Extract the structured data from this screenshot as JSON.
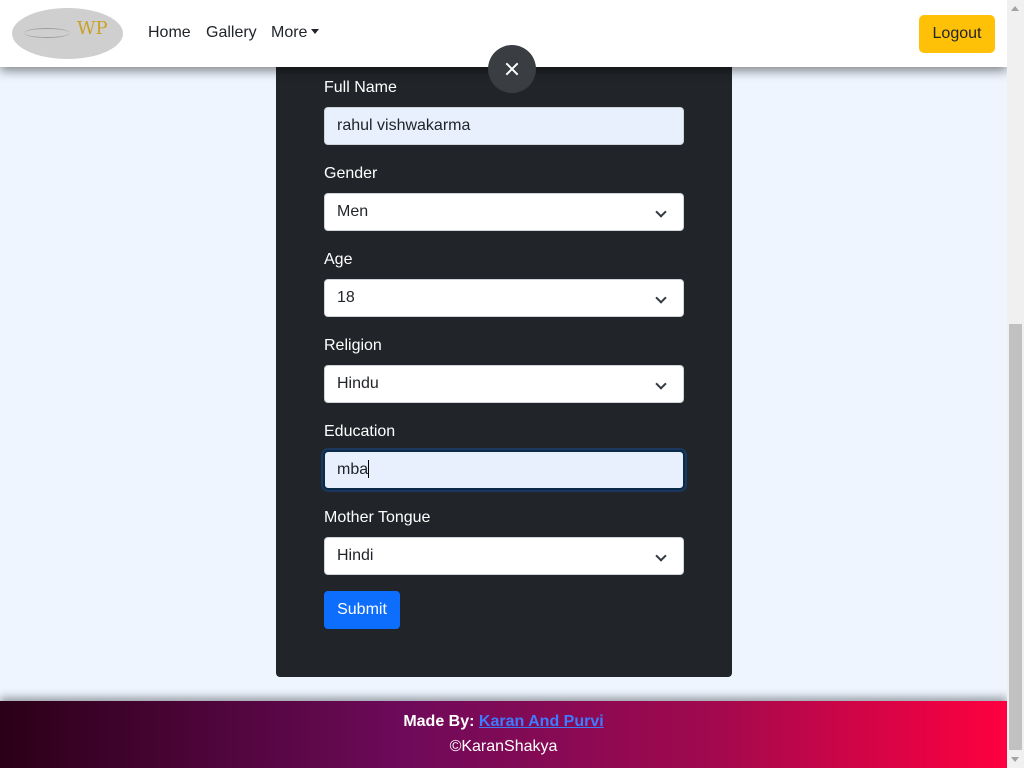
{
  "navbar": {
    "logo_text": "WP",
    "links": [
      "Home",
      "Gallery",
      "More"
    ],
    "logout_label": "Logout",
    "logout_color": "#ffc107"
  },
  "modal": {
    "close_icon": "close-icon",
    "fields": {
      "full_name": {
        "label": "Full Name",
        "value": "rahul vishwakarma"
      },
      "gender": {
        "label": "Gender",
        "value": "Men"
      },
      "age": {
        "label": "Age",
        "value": "18"
      },
      "religion": {
        "label": "Religion",
        "value": "Hindu"
      },
      "education": {
        "label": "Education",
        "value": "mba"
      },
      "mother_tongue": {
        "label": "Mother Tongue",
        "value": "Hindi"
      }
    },
    "submit_label": "Submit",
    "submit_color": "#0d6efd"
  },
  "footer": {
    "made_by_prefix": "Made By:",
    "made_by_link": "Karan And Purvi",
    "copyright": "©KaranShakya"
  }
}
